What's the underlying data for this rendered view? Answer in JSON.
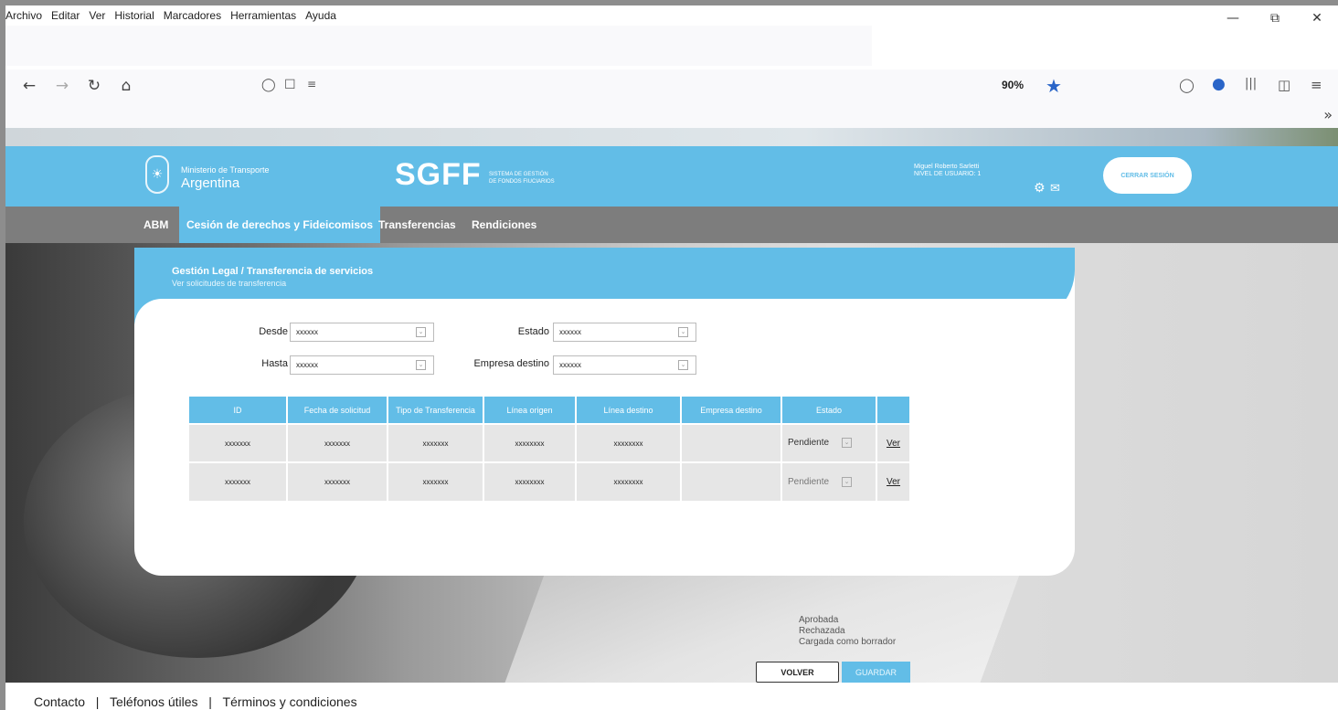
{
  "browser": {
    "menu": [
      "Archivo",
      "Editar",
      "Ver",
      "Historial",
      "Marcadores",
      "Herramientas",
      "Ayuda"
    ],
    "zoom": "90%",
    "window_controls": [
      "minimize-icon",
      "restore-icon",
      "close-icon"
    ],
    "icons": [
      "back-icon",
      "forward-icon",
      "reload-icon",
      "home-icon",
      "shield-icon",
      "lock-icon",
      "permissions-icon",
      "star-icon",
      "pocket-icon",
      "account-icon",
      "library-icon",
      "sidebar-icon",
      "menu-icon",
      "overflow-chevron-icon"
    ]
  },
  "header": {
    "ministry": "Ministerio de Transporte",
    "country": "Argentina",
    "app_name": "SGFF",
    "app_sub_1": "SISTEMA DE GESTIÓN",
    "app_sub_2": "DE FONDOS FIUCIARIOS",
    "user_name": "Miguel Roberto Sarletti",
    "user_level": "NIVEL DE USUARIO: 1",
    "logout_label": "CERRAR SESIÓN",
    "brand_color": "#62bde7"
  },
  "nav": {
    "items": [
      {
        "label": "ABM",
        "active": false
      },
      {
        "label": "Cesión de derechos y Fideicomisos",
        "active": true
      },
      {
        "label": "Transferencias",
        "active": false
      },
      {
        "label": "Rendiciones",
        "active": false
      }
    ]
  },
  "card": {
    "breadcrumb": "Gestión Legal / Transferencia de servicios",
    "subtitle": "Ver solicitudes de transferencia"
  },
  "filters": {
    "desde_label": "Desde",
    "desde_value": "xxxxxx",
    "hasta_label": "Hasta",
    "hasta_value": "xxxxxx",
    "estado_label": "Estado",
    "estado_value": "xxxxxx",
    "empresa_label": "Empresa destino",
    "empresa_value": "xxxxxx"
  },
  "table": {
    "headers": [
      "ID",
      "Fecha de solicitud",
      "Tipo de Transferencia",
      "Línea origen",
      "Línea destino",
      "Empresa destino",
      "Estado",
      ""
    ],
    "rows": [
      {
        "id": "xxxxxxx",
        "fecha": "xxxxxxx",
        "tipo": "xxxxxxx",
        "origen": "xxxxxxxx",
        "destino": "xxxxxxxx",
        "empresa": "",
        "estado": "Pendiente",
        "action": "Ver"
      },
      {
        "id": "xxxxxxx",
        "fecha": "xxxxxxx",
        "tipo": "xxxxxxx",
        "origen": "xxxxxxxx",
        "destino": "xxxxxxxx",
        "empresa": "",
        "estado": "Pendiente",
        "action": "Ver"
      }
    ],
    "estado_options": [
      "Aprobada",
      "Rechazada",
      "Cargada como borrador"
    ]
  },
  "buttons": {
    "volver": "VOLVER",
    "guardar": "GUARDAR"
  },
  "footer": {
    "links": [
      "Contacto",
      "Teléfonos útiles",
      "Términos y condiciones"
    ],
    "separator": "|"
  }
}
